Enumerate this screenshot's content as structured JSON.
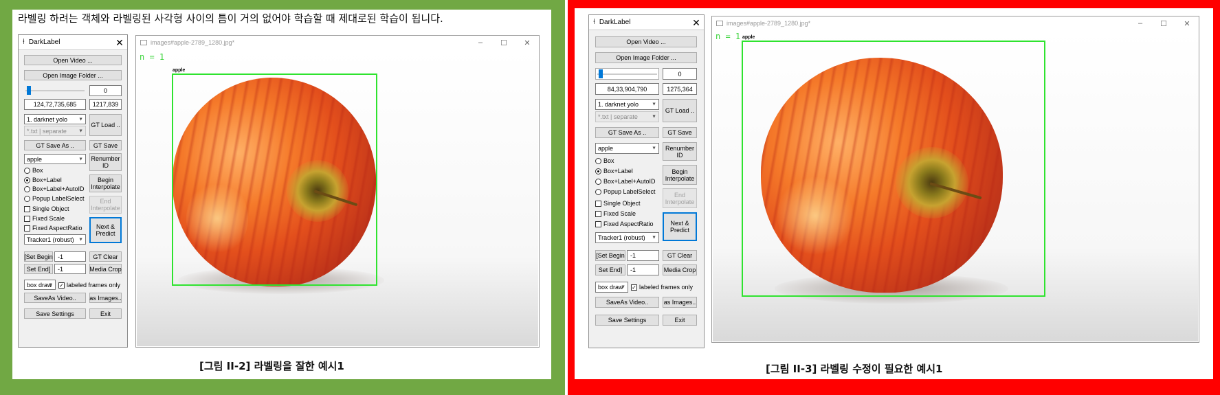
{
  "panels": [
    {
      "description": "라벨링 하려는 객체와 라벨링된 사각형 사이의 틈이 거의 없어야 학습할 때 제대로된 학습이 됩니다.",
      "caption": "[그림 II-2] 라벨링을 잘한 예시1",
      "frame_color": "#71a844",
      "darklabel": {
        "title": "DarkLabel",
        "open_video": "Open Video ...",
        "open_image_folder": "Open Image Folder ...",
        "frame_number": "0",
        "cursor_info": "124,72,735,685",
        "image_size": "1217,839",
        "format_select": "1. darknet yolo",
        "format_option": "*.txt | separate",
        "gt_load": "GT Load ..",
        "gt_save_as": "GT Save As ..",
        "gt_save": "GT Save",
        "label_select": "apple",
        "renumber_id": "Renumber ID",
        "mode_box": "Box",
        "mode_box_label": "Box+Label",
        "mode_box_label_autoid": "Box+Label+AutoID",
        "mode_popup": "Popup LabelSelect",
        "selected_mode": "Box+Label",
        "begin_interpolate": "Begin Interpolate",
        "end_interpolate": "End Interpolate",
        "single_object": "Single Object",
        "fixed_scale": "Fixed Scale",
        "fixed_aspect_ratio": "Fixed AspectRatio",
        "next_predict": "Next & Predict",
        "tracker": "Tracker1 (robust)",
        "set_begin": "[Set Begin",
        "set_begin_value": "-1",
        "set_end": "Set End]",
        "set_end_value": "-1",
        "gt_clear": "GT Clear",
        "media_crop": "Media Crop",
        "draw_mode": "box draw",
        "labeled_frames_only": "labeled frames only",
        "labeled_frames_checked": "✓",
        "save_as_video": "SaveAs Video..",
        "as_images": "as Images..",
        "save_settings": "Save Settings",
        "exit": "Exit"
      },
      "image_window": {
        "title": "images#apple-2789_1280.jpg*",
        "object_count": "n = 1",
        "box_label": "apple",
        "minimize": "–",
        "maximize": "☐",
        "close": "✕"
      }
    },
    {
      "caption": "[그림 II-3] 라벨링 수정이 필요한 예시1",
      "frame_color": "#ff0000",
      "darklabel": {
        "title": "DarkLabel",
        "open_video": "Open Video ...",
        "open_image_folder": "Open Image Folder ...",
        "frame_number": "0",
        "cursor_info": "84,33,904,790",
        "image_size": "1275,364",
        "format_select": "1. darknet yolo",
        "format_option": "*.txt | separate",
        "gt_load": "GT Load ..",
        "gt_save_as": "GT Save As ..",
        "gt_save": "GT Save",
        "label_select": "apple",
        "renumber_id": "Renumber ID",
        "mode_box": "Box",
        "mode_box_label": "Box+Label",
        "mode_box_label_autoid": "Box+Label+AutoID",
        "mode_popup": "Popup LabelSelect",
        "selected_mode": "Box+Label",
        "begin_interpolate": "Begin Interpolate",
        "end_interpolate": "End Interpolate",
        "single_object": "Single Object",
        "fixed_scale": "Fixed Scale",
        "fixed_aspect_ratio": "Fixed AspectRatio",
        "next_predict": "Next & Predict",
        "tracker": "Tracker1 (robust)",
        "set_begin": "[Set Begin",
        "set_begin_value": "-1",
        "set_end": "Set End]",
        "set_end_value": "-1",
        "gt_clear": "GT Clear",
        "media_crop": "Media Crop",
        "draw_mode": "box draw",
        "labeled_frames_only": "labeled frames only",
        "labeled_frames_checked": "✓",
        "save_as_video": "SaveAs Video..",
        "as_images": "as Images..",
        "save_settings": "Save Settings",
        "exit": "Exit"
      },
      "image_window": {
        "title": "images#apple-2789_1280.jpg*",
        "object_count": "n = 1",
        "box_label": "apple",
        "minimize": "–",
        "maximize": "☐",
        "close": "✕"
      }
    }
  ]
}
